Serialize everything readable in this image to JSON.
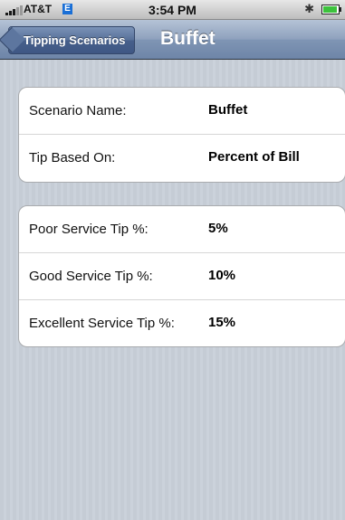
{
  "status_bar": {
    "carrier": "AT&T",
    "network": "E",
    "time": "3:54 PM",
    "bluetooth": "bluetooth-icon",
    "battery": "battery-icon"
  },
  "nav": {
    "back_label": "Tipping Scenarios",
    "title": "Buffet"
  },
  "scenario": {
    "rows": [
      {
        "label": "Scenario Name:",
        "value": "Buffet"
      },
      {
        "label": "Tip Based On:",
        "value": "Percent of Bill"
      }
    ]
  },
  "tips": {
    "rows": [
      {
        "label": "Poor Service Tip %:",
        "value": "5%"
      },
      {
        "label": "Good Service Tip %:",
        "value": "10%"
      },
      {
        "label": "Excellent Service Tip %:",
        "value": "15%"
      }
    ]
  },
  "colors": {
    "nav_bar": "#8ea1bd",
    "back_button": "#566f98",
    "edge_badge": "#1a6fd6"
  }
}
